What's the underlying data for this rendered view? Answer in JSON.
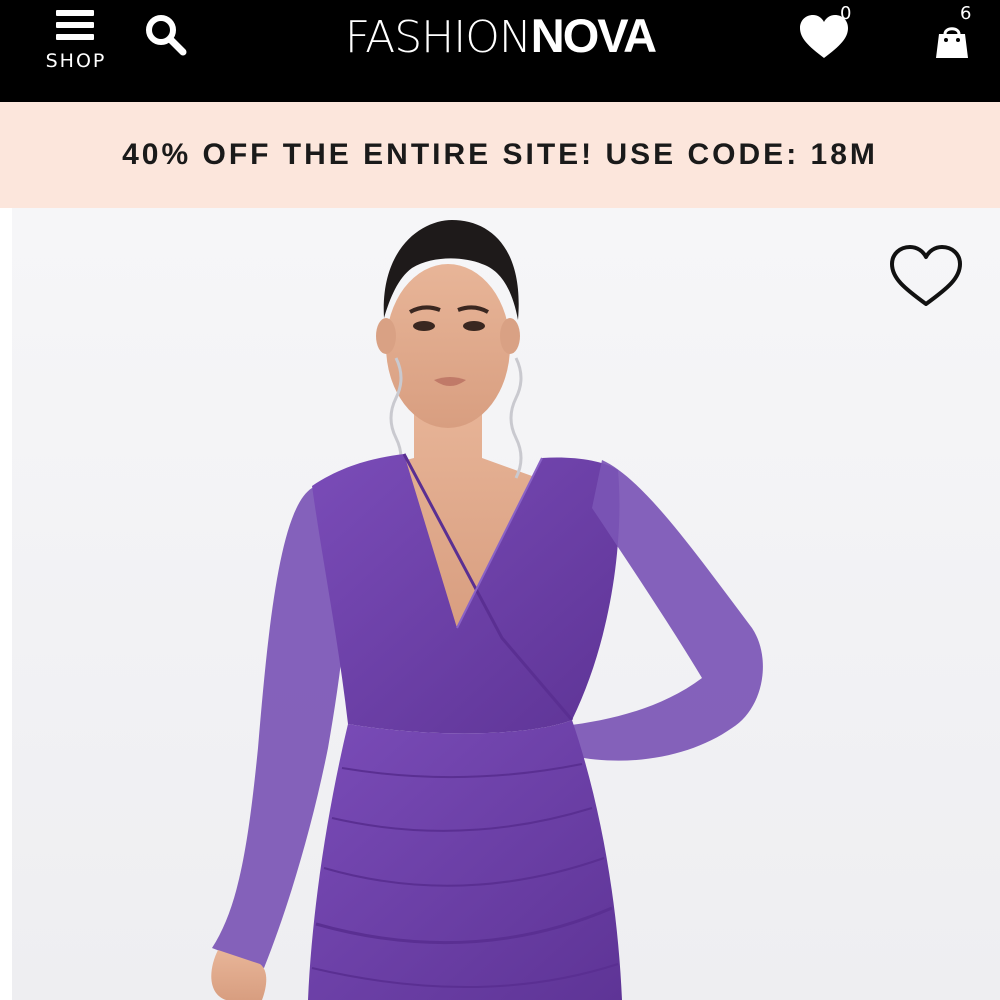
{
  "header": {
    "menu_label": "SHOP",
    "logo": {
      "light_part": "FASHION",
      "bold_part": "NOVA"
    },
    "wishlist_count": "0",
    "cart_count": "6",
    "icons": [
      "menu-icon",
      "search-icon",
      "heart-icon",
      "shopping-bag-icon"
    ]
  },
  "promo": {
    "text": "40% OFF THE ENTIRE SITE! USE CODE: 18M"
  },
  "product": {
    "image_icon": "product-photo",
    "favorite_icon": "heart-outline-icon",
    "dress_color": "#6b3fa6"
  },
  "colors": {
    "header_bg": "#000000",
    "promo_bg": "#fce6dc",
    "promo_text": "#1a1a1a",
    "dress": "#6b3fa6"
  }
}
